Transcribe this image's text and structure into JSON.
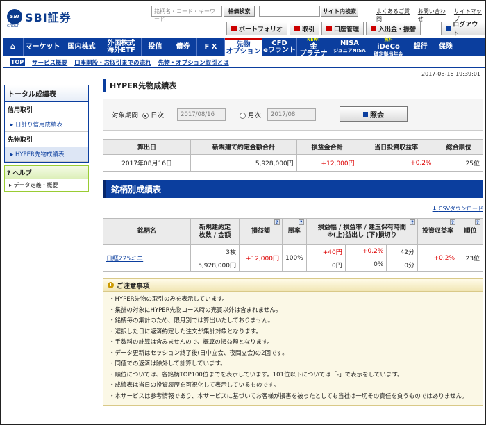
{
  "header": {
    "logo_mark": "SBI",
    "logo_text": "SBI証券",
    "logo_sub": "GROUP",
    "stock_search_placeholder": "銘柄名・コード・キーワード",
    "stock_search_button": "株価検索",
    "site_search_button": "サイト内検索",
    "links": [
      "よくあるご質問",
      "お問い合わせ",
      "サイトマップ"
    ],
    "nav_buttons": [
      "ポートフォリオ",
      "取引",
      "口座管理",
      "入出金・振替"
    ],
    "logout": "ログアウト"
  },
  "menu": [
    {
      "label": "⌂",
      "name": "home"
    },
    {
      "label": "マーケット",
      "name": "market"
    },
    {
      "label": "国内株式",
      "name": "domestic-stocks"
    },
    {
      "label": "外国株式",
      "label2": "海外ETF",
      "name": "foreign-stocks"
    },
    {
      "label": "投信",
      "name": "funds"
    },
    {
      "label": "債券",
      "name": "bonds"
    },
    {
      "label": "F X",
      "name": "fx"
    },
    {
      "label": "先物",
      "label2": "オプション",
      "name": "futures",
      "active": true
    },
    {
      "label": "CFD",
      "label2": "eワラント",
      "name": "cfd"
    },
    {
      "label": "金",
      "label2": "プラチナ",
      "badge": "NEW!",
      "name": "gold"
    },
    {
      "label": "NISA",
      "label2": "ジュニアNISA",
      "name": "nisa"
    },
    {
      "label": "iDeCo",
      "label2": "確定拠出年金",
      "badge": "無料",
      "name": "ideco"
    },
    {
      "label": "銀行",
      "name": "bank"
    },
    {
      "label": "保険",
      "name": "insurance"
    }
  ],
  "subnav": {
    "tag": "TOP",
    "links": [
      "サービス概要",
      "口座開設・お取引までの流れ",
      "先物・オプション取引とは"
    ]
  },
  "timestamp": "2017-08-16 19:39:01",
  "sidebar": {
    "header": "トータル成績表",
    "sections": [
      {
        "title": "信用取引",
        "items": [
          "日計り信用成績表"
        ]
      },
      {
        "title": "先物取引",
        "items": [
          "HYPER先物成績表"
        ]
      }
    ],
    "help_title": "ヘルプ",
    "help_items": [
      "データ定義・概要"
    ]
  },
  "main": {
    "title": "HYPER先物成績表",
    "period_label": "対象期間",
    "daily_label": "日次",
    "daily_value": "2017/08/16",
    "monthly_label": "月次",
    "monthly_value": "2017/08",
    "view_button": "照会",
    "summary": {
      "headers": [
        "算出日",
        "新規建て約定金額合計",
        "損益金合計",
        "当日投資収益率",
        "総合順位"
      ],
      "row": [
        "2017年08月16日",
        "5,928,000円",
        "+12,000円",
        "+0.2%",
        "25位"
      ]
    },
    "by_issue_title": "銘柄別成績表",
    "csv_link": "CSVダウンロード",
    "issues": {
      "headers": [
        "銘柄名",
        "新規建約定",
        "枚数 / 金額",
        "損益額",
        "勝率",
        "損益幅 / 損益率 / 建玉保有時間",
        "※(上)益出し (下)損切り",
        "投資収益率",
        "順位"
      ],
      "row": {
        "name": "日経225ミニ",
        "qty": "3枚",
        "amount": "5,928,000円",
        "pl": "+12,000円",
        "winrate": "100%",
        "upper": [
          "+40円",
          "+0.2%",
          "42分"
        ],
        "lower": [
          "0円",
          "0%",
          "0分"
        ],
        "roi": "+0.2%",
        "rank": "23位"
      }
    },
    "notice_title": "ご注意事項",
    "notice_items": [
      "HYPER先物の取引のみを表示しています。",
      "集計の対象にHYPER先物コース時の売買以外は含まれません。",
      "銘柄毎の集計のため、限月別では算出いたしておりません。",
      "選択した日に返済約定した注文が集計対象となります。",
      "手数料の計算は含みませんので、概算の損益額となります。",
      "データ更新はセッション終了後(日中立会、夜間立会)の2回です。",
      "同値での返済は除外して計算しています。",
      "順位については、各銘柄TOP100位までを表示しています。101位以下については「-」で表示をしています。",
      "成績表は当日の投資履歴を可視化して表示しているものです。",
      "本サービスは参考情報であり、本サービスに基づいてお客様が損害を被ったとしても当社は一切その責任を負うものではありません。"
    ]
  }
}
